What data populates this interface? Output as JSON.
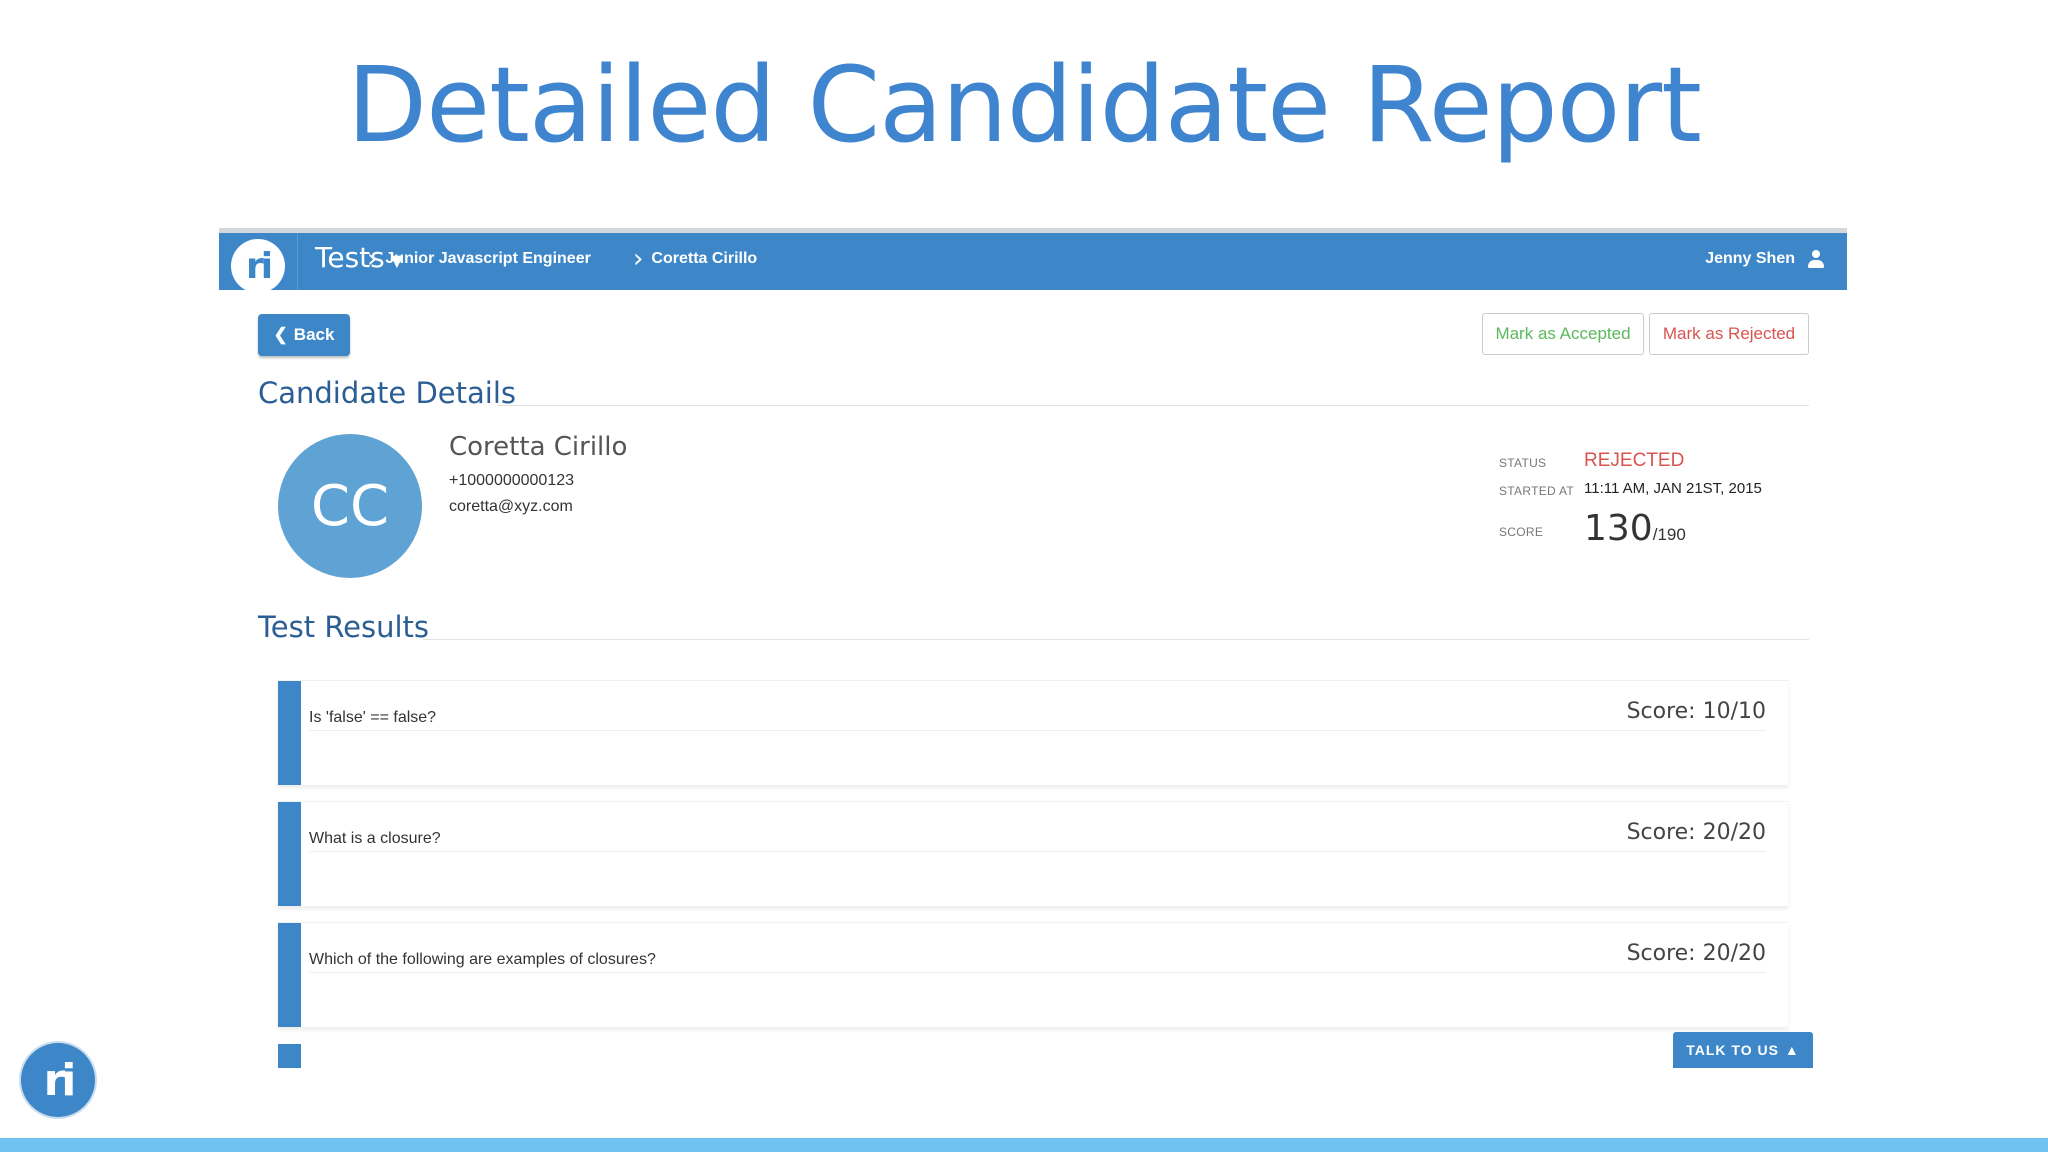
{
  "slide": {
    "title": "Detailed Candidate Report"
  },
  "topbar": {
    "logo": "ri",
    "nav_tests": "Tests",
    "breadcrumbs": [
      "Junior Javascript Engineer",
      "Coretta Cirillo"
    ],
    "user_name": "Jenny Shen"
  },
  "actions": {
    "back": "Back",
    "accept": "Mark as Accepted",
    "reject": "Mark as Rejected"
  },
  "candidate": {
    "section_title": "Candidate Details",
    "initials": "CC",
    "name": "Coretta Cirillo",
    "phone": "+1000000000123",
    "email": "coretta@xyz.com",
    "status_label": "STATUS",
    "status": "REJECTED",
    "started_label": "STARTED AT",
    "started": "11:11 AM, JAN 21ST, 2015",
    "score_label": "SCORE",
    "score": "130",
    "score_total": "/190"
  },
  "results": {
    "section_title": "Test Results",
    "items": [
      {
        "question": "Is 'false' == false?",
        "score": "Score: 10/10"
      },
      {
        "question": "What is a closure?",
        "score": "Score: 20/20"
      },
      {
        "question": "Which of the following are examples of closures?",
        "score": "Score: 20/20"
      }
    ]
  },
  "talk_to_us": "TALK TO US",
  "corner_logo": "ri",
  "colors": {
    "brand": "#3d87c9",
    "accept": "#5cb85c",
    "reject": "#d9534f",
    "title": "#3f84cf",
    "band": "#6ec3f0"
  }
}
